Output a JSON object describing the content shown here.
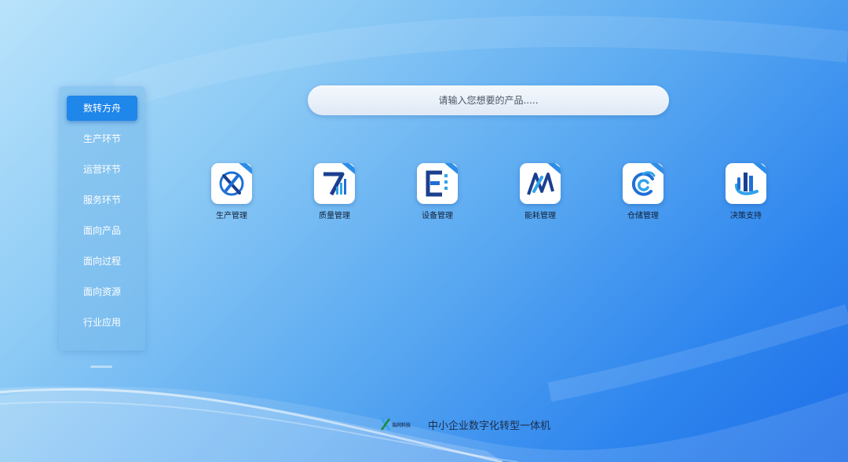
{
  "sidebar": {
    "items": [
      {
        "label": "数转方舟",
        "active": true
      },
      {
        "label": "生产环节"
      },
      {
        "label": "运营环节"
      },
      {
        "label": "服务环节"
      },
      {
        "label": "面向产品"
      },
      {
        "label": "面向过程"
      },
      {
        "label": "面向资源"
      },
      {
        "label": "行业应用"
      }
    ]
  },
  "search": {
    "placeholder": "请输入您想要的产品....."
  },
  "apps": [
    {
      "label": "生产管理",
      "icon": "production-icon"
    },
    {
      "label": "质量管理",
      "icon": "quality-icon"
    },
    {
      "label": "设备管理",
      "icon": "equipment-icon"
    },
    {
      "label": "能耗管理",
      "icon": "energy-icon"
    },
    {
      "label": "仓储管理",
      "icon": "warehouse-icon"
    },
    {
      "label": "决策支持",
      "icon": "decision-icon"
    }
  ],
  "footer": {
    "logo_text": "浩同科技",
    "title": "中小企业数字化转型一体机"
  },
  "colors": {
    "accent": "#1f86ea",
    "icon_blue": "#1f6fd6",
    "icon_dark": "#1b3f8f"
  }
}
